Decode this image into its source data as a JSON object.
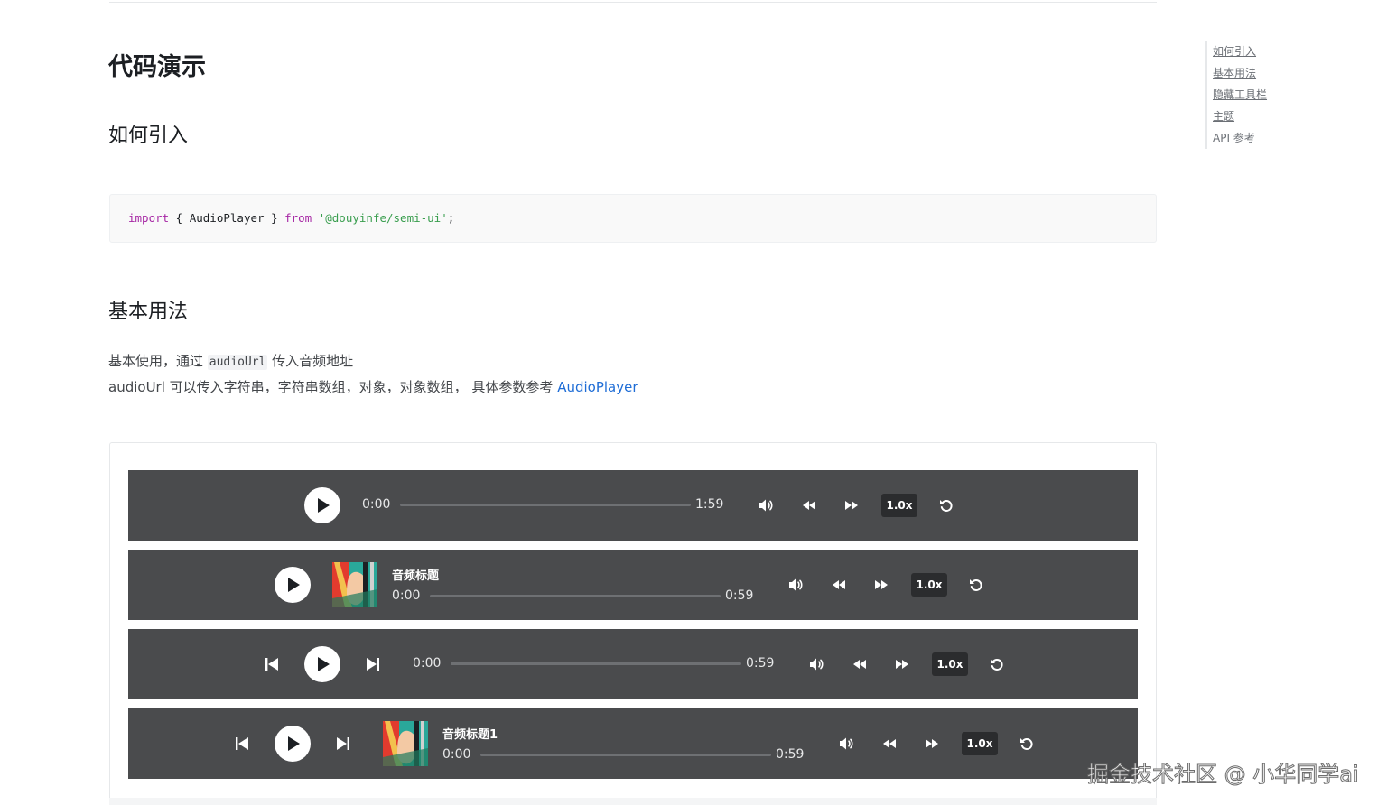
{
  "page": {
    "title": "代码演示",
    "section_import": "如何引入",
    "section_basic": "基本用法",
    "code": {
      "kw_import": "import",
      "middle": " { AudioPlayer } ",
      "kw_from": "from",
      "space": " ",
      "string": "'@douyinfe/semi-ui'",
      "end": ";"
    },
    "desc1_before": "基本使用，通过 ",
    "desc1_code": "audioUrl",
    "desc1_after": " 传入音频地址",
    "desc2_text": "audioUrl 可以传入字符串，字符串数组，对象，对象数组， 具体参数参考 ",
    "desc2_link": "AudioPlayer"
  },
  "toc": [
    "如何引入",
    "基本用法",
    "隐藏工具栏",
    "主题",
    "API 参考"
  ],
  "players": [
    {
      "current_time": "0:00",
      "duration": "1:59",
      "speed": "1.0x",
      "progress": 0
    },
    {
      "title": "音频标题",
      "current_time": "0:00",
      "duration": "0:59",
      "speed": "1.0x",
      "progress": 0
    },
    {
      "current_time": "0:00",
      "duration": "0:59",
      "speed": "1.0x",
      "progress": 0
    },
    {
      "title": "音频标题1",
      "current_time": "0:00",
      "duration": "0:59",
      "speed": "1.0x",
      "progress": 0
    }
  ],
  "icons": {
    "play": "play-icon",
    "volume": "volume-icon",
    "rewind": "rewind-icon",
    "forward": "fast-forward-icon",
    "refresh": "refresh-icon",
    "prev": "skip-previous-icon",
    "next": "skip-next-icon"
  },
  "watermark": "掘金技术社区 @ 小华同学ai"
}
